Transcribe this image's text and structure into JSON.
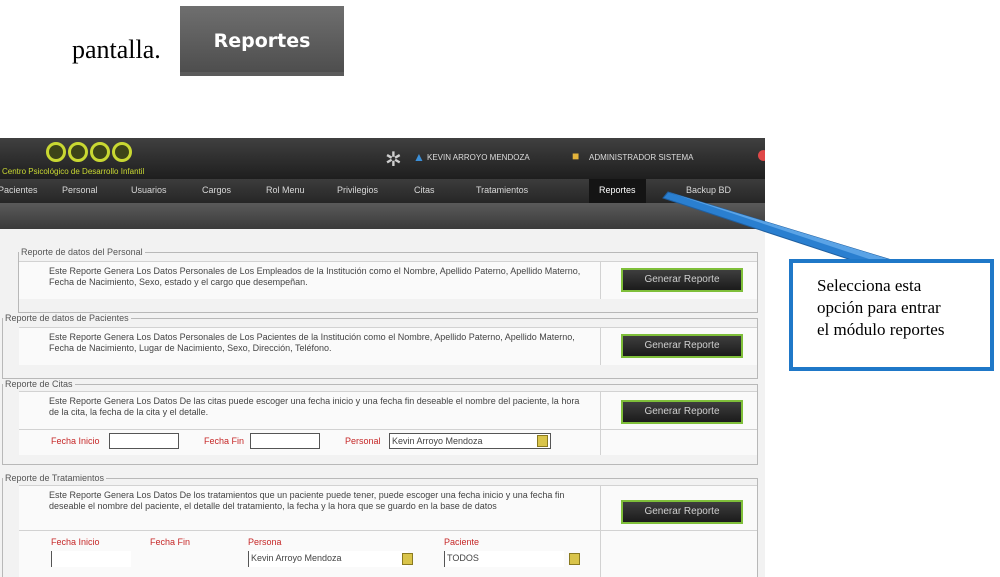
{
  "doc": {
    "intro_text": "pantalla.",
    "button_label": "Reportes"
  },
  "app": {
    "logo_text": "Centro Psicológico de Desarrollo Infantil",
    "user_name": "KEVIN ARROYO MENDOZA",
    "role": "ADMINISTRADOR SISTEMA"
  },
  "nav": {
    "items": [
      "Pacientes",
      "Personal",
      "Usuarios",
      "Cargos",
      "Rol Menu",
      "Privilegios",
      "Citas",
      "Tratamientos",
      "Reportes",
      "Backup BD"
    ],
    "active": "Reportes"
  },
  "sections": [
    {
      "legend": "Reporte de datos del Personal",
      "description": "Este Reporte Genera Los Datos Personales de Los Empleados de la Institución como el Nombre, Apellido Paterno, Apellido Materno, Fecha de Nacimiento, Sexo, estado y el cargo que desempeñan.",
      "button": "Generar Reporte"
    },
    {
      "legend": "Reporte de datos de Pacientes",
      "description": "Este Reporte Genera Los Datos Personales de Los Pacientes de la Institución como el Nombre, Apellido Paterno, Apellido Materno, Fecha de Nacimiento, Lugar de Nacimiento, Sexo, Dirección, Teléfono.",
      "button": "Generar Reporte"
    },
    {
      "legend": "Reporte de Citas",
      "description": "Este Reporte Genera Los Datos De las citas puede escoger una fecha inicio y una fecha fin deseable el nombre del paciente, la hora de la cita, la fecha de la cita y el detalle.",
      "button": "Generar Reporte",
      "fields": {
        "fecha_inicio_label": "Fecha Inicio",
        "fecha_fin_label": "Fecha Fin",
        "personal_label": "Personal",
        "personal_value": "Kevin Arroyo Mendoza"
      }
    },
    {
      "legend": "Reporte de Tratamientos",
      "description": "Este Reporte Genera Los Datos De los tratamientos que un paciente puede tener, puede escoger una fecha inicio y una fecha fin deseable el nombre del paciente, el detalle del tratamiento, la fecha y la hora que se guardo en la base de datos",
      "button": "Generar Reporte",
      "fields": {
        "fecha_inicio_label": "Fecha Inicio",
        "fecha_fin_label": "Fecha Fin",
        "persona_label": "Persona",
        "persona_value": "Kevin Arroyo Mendoza",
        "paciente_label": "Paciente",
        "paciente_value": "TODOS"
      }
    }
  ],
  "callout": {
    "line1": "Selecciona esta",
    "line2": "opción para entrar",
    "line3": "el módulo reportes"
  },
  "colors": {
    "accent_green": "#7fbf3a",
    "callout_blue": "#1f78c8",
    "label_red": "#c62828",
    "logo_yellow": "#c9d832"
  }
}
